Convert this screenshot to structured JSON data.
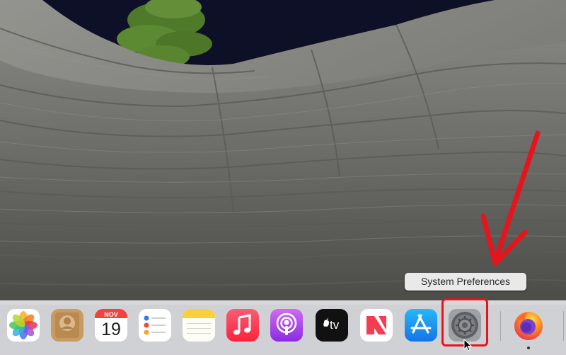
{
  "tooltip": {
    "text": "System Preferences"
  },
  "dock": {
    "items": [
      {
        "name": "photos",
        "icon": "photos-icon"
      },
      {
        "name": "contacts",
        "icon": "contacts-icon"
      },
      {
        "name": "calendar",
        "icon": "calendar-icon",
        "month": "NOV",
        "day": "19"
      },
      {
        "name": "reminders",
        "icon": "reminders-icon"
      },
      {
        "name": "notes",
        "icon": "notes-icon"
      },
      {
        "name": "music",
        "icon": "music-icon"
      },
      {
        "name": "podcasts",
        "icon": "podcasts-icon"
      },
      {
        "name": "tv",
        "icon": "tv-icon",
        "label": "tv"
      },
      {
        "name": "news",
        "icon": "news-icon"
      },
      {
        "name": "app-store",
        "icon": "app-store-icon"
      },
      {
        "name": "system-preferences",
        "icon": "gear-icon"
      },
      {
        "name": "firefox",
        "icon": "firefox-icon",
        "running": true
      }
    ]
  },
  "annotation": {
    "highlight_color": "#e8141c",
    "arrow_color": "#e8141c"
  }
}
